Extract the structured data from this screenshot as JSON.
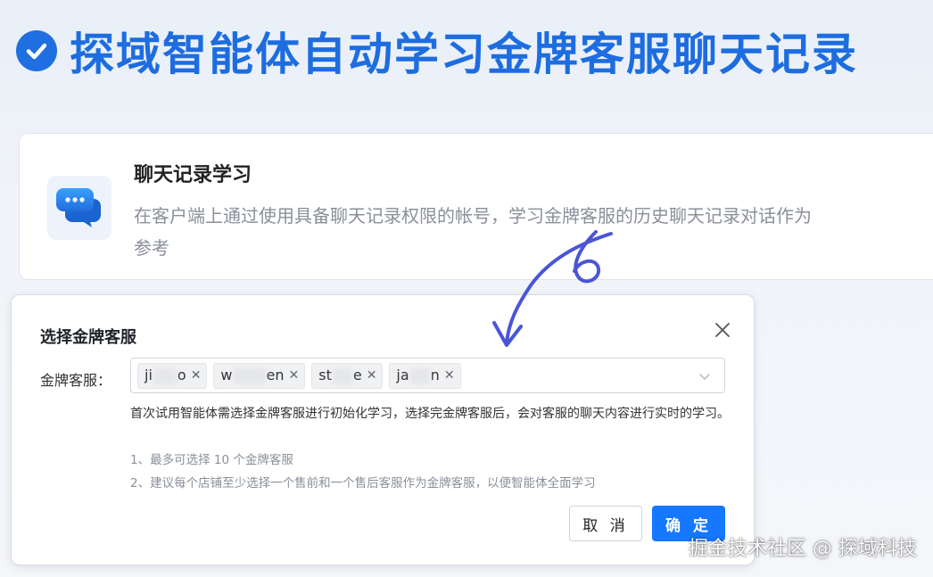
{
  "banner": {
    "title": "探域智能体自动学习金牌客服聊天记录",
    "icon": "check-circle-icon",
    "accent_color": "#1d6de0"
  },
  "card": {
    "title": "聊天记录学习",
    "description": "在客户端上通过使用具备聊天记录权限的帐号，学习金牌客服的历史聊天记录对话作为参考",
    "icon": "chat-bubbles-icon"
  },
  "dialog": {
    "title": "选择金牌客服",
    "field_label": "金牌客服：",
    "tags": [
      {
        "start": "ji",
        "end": "o"
      },
      {
        "start": "w",
        "end": "en"
      },
      {
        "start": "st",
        "end": "e"
      },
      {
        "start": "ja",
        "end": "n"
      }
    ],
    "help_text": "首次试用智能体需选择金牌客服进行初始化学习，选择完金牌客服后，会对客服的聊天内容进行实时的学习。",
    "rule_1": "1、最多可选择 10 个金牌客服",
    "rule_2": "2、建议每个店铺至少选择一个售前和一个售后客服作为金牌客服，以便智能体全面学习",
    "cancel_label": "取 消",
    "ok_label": "确 定",
    "primary_color": "#1677ff"
  },
  "annotation": {
    "handwritten_mark": "6",
    "arrow_color": "#4a55d6"
  },
  "watermark": "掘金技术社区 @ 探域科技"
}
